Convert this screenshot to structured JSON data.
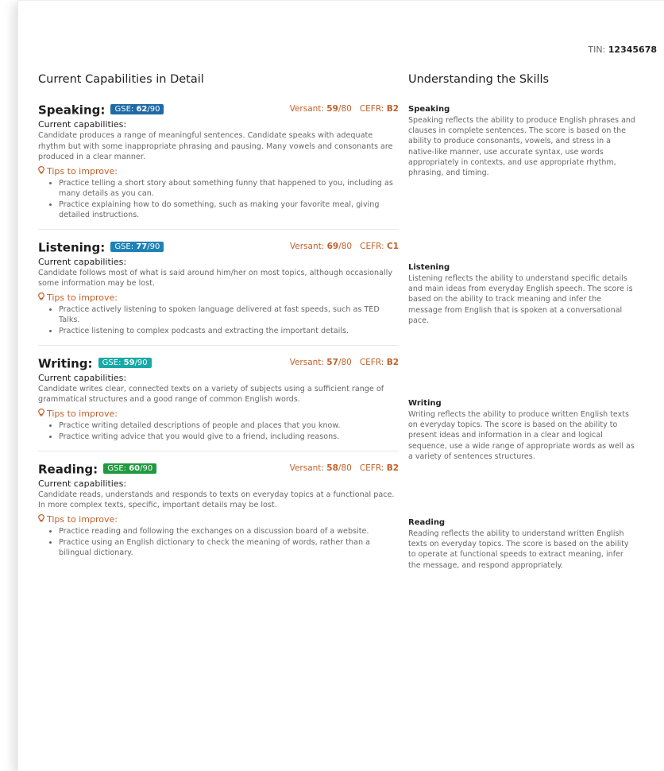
{
  "tin": {
    "label": "TIN:",
    "value": "12345678"
  },
  "headings": {
    "left": "Current Capabilities in Detail",
    "right": "Understanding the Skills"
  },
  "common": {
    "cap_label": "Current capabilities:",
    "tips_label": "Tips to improve:",
    "gse_prefix": "GSE:",
    "gse_max": "/90",
    "versant_prefix": "Versant:",
    "versant_max": "/80",
    "cefr_prefix": "CEFR:"
  },
  "colors": {
    "gse_speaking": "#1f6aa5",
    "gse_listening": "#1e82b6",
    "gse_writing": "#17a9a6",
    "gse_reading": "#1f9a3e",
    "accent": "#c0612b"
  },
  "skills": [
    {
      "name": "Speaking:",
      "gse": "62",
      "versant": "59",
      "cefr": "B2",
      "capabilities": "Candidate produces a range of meaningful sentences. Candidate speaks with adequate rhythm but with some inappropriate phrasing and pausing. Many vowels and consonants are produced in a clear manner.",
      "tips": [
        "Practice telling a short story about something funny that happened to you, including as many details as you can.",
        "Practice explaining how to do something, such as making your favorite meal, giving detailed instructions."
      ]
    },
    {
      "name": "Listening:",
      "gse": "77",
      "versant": "69",
      "cefr": "C1",
      "capabilities": "Candidate follows most of what is said around him/her on most topics, although occasionally some information may be lost.",
      "tips": [
        "Practice actively listening to spoken language delivered at fast speeds, such as TED Talks.",
        "Practice listening to complex podcasts and extracting the important details."
      ]
    },
    {
      "name": "Writing:",
      "gse": "59",
      "versant": "57",
      "cefr": "B2",
      "capabilities": "Candidate writes clear, connected texts on a variety of subjects using a sufficient range of grammatical structures and a good range of common English words.",
      "tips": [
        "Practice writing detailed descriptions of people and places that you know.",
        "Practice writing advice that you would give to a friend, including reasons."
      ]
    },
    {
      "name": "Reading:",
      "gse": "60",
      "versant": "58",
      "cefr": "B2",
      "capabilities": "Candidate reads, understands and responds to texts on everyday topics at a functional pace. In more complex texts, specific, important details may be lost.",
      "tips": [
        "Practice reading and following the exchanges on a discussion board of a website.",
        "Practice using an English dictionary to check the meaning of words, rather than a bilingual dictionary."
      ]
    }
  ],
  "understanding": [
    {
      "title": "Speaking",
      "text": "Speaking reflects the ability to produce English phrases and clauses in complete sentences. The score is based on the ability to produce consonants, vowels, and stress in a native-like manner, use accurate syntax, use words appropriately in contexts, and use appropriate rhythm, phrasing, and timing."
    },
    {
      "title": "Listening",
      "text": "Listening reflects the ability to understand specific details and main ideas from everyday English speech. The score is based on the ability to track meaning and infer the message from English that is spoken at a conversational pace."
    },
    {
      "title": "Writing",
      "text": "Writing reflects the ability to produce written English texts on everyday topics. The score is based on the ability to present ideas and information in a clear and logical sequence, use a wide range of appropriate words as well as a variety of sentences structures."
    },
    {
      "title": "Reading",
      "text": "Reading reflects the ability to understand written English texts on everyday topics. The score is based on the ability to operate at functional speeds to extract meaning, infer the message, and respond appropriately."
    }
  ]
}
